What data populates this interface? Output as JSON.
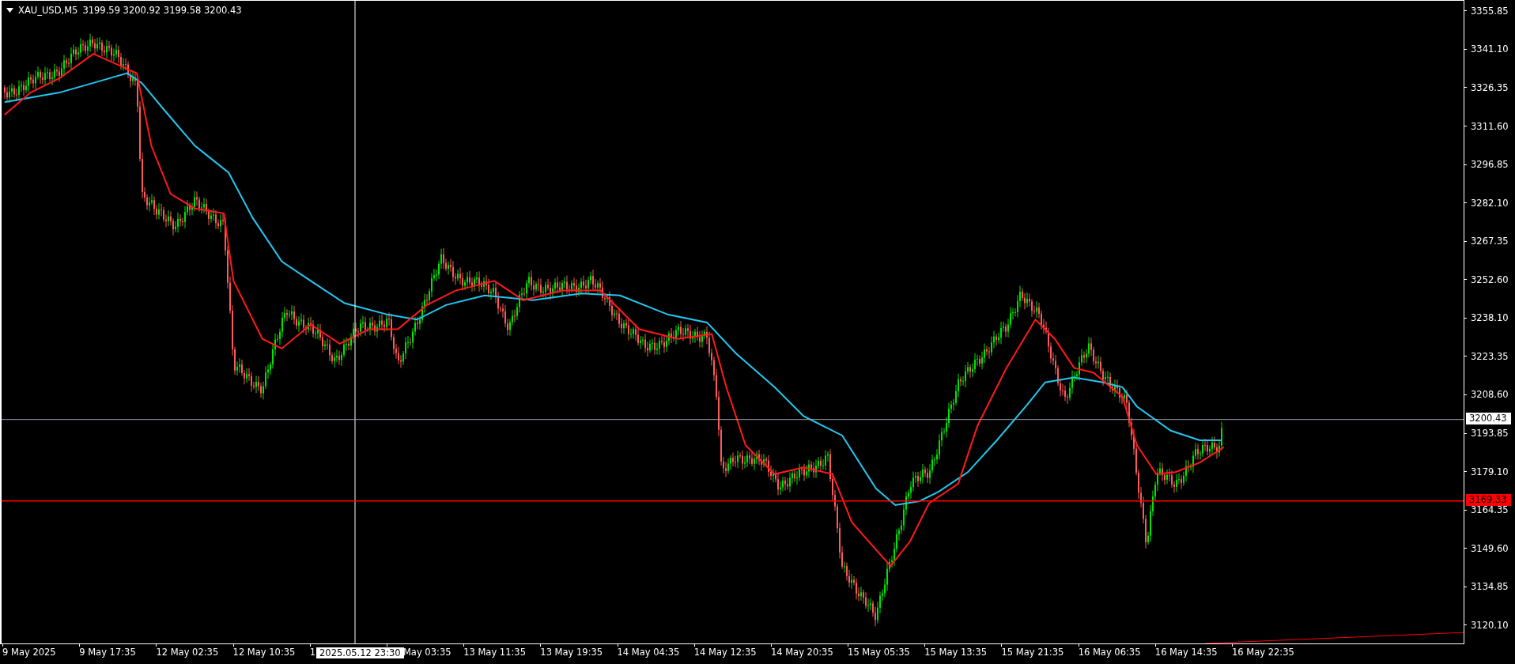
{
  "chart": {
    "symbol": "XAU_USD,M5",
    "ohlc": "3199.59 3200.92 3199.58 3200.43"
  },
  "y_axis": {
    "labels": [
      "3355.85",
      "3341.10",
      "3326.35",
      "3311.60",
      "3296.85",
      "3282.10",
      "3267.35",
      "3252.60",
      "3238.10",
      "3223.35",
      "3208.60",
      "3193.85",
      "3179.10",
      "3164.35",
      "3149.60",
      "3134.85",
      "3120.10"
    ]
  },
  "price_tags": [
    {
      "kind": "bid",
      "text": "3200.43"
    },
    {
      "kind": "line",
      "text": "3169.33"
    }
  ],
  "x_axis": {
    "labels": [
      {
        "text": "9 May 2025",
        "kind": "full"
      },
      {
        "text": "9 May 17:35",
        "kind": "full"
      },
      {
        "text": "12 May 02:35",
        "kind": "full"
      },
      {
        "text": "12 May 10:35",
        "kind": "full"
      },
      {
        "text": "1",
        "kind": "cut_right"
      },
      {
        "text": "May 03:35",
        "kind": "cut_left"
      },
      {
        "text": "13 May 11:35",
        "kind": "full"
      },
      {
        "text": "13 May 19:35",
        "kind": "full"
      },
      {
        "text": "14 May 04:35",
        "kind": "full"
      },
      {
        "text": "14 May 12:35",
        "kind": "full"
      },
      {
        "text": "14 May 20:35",
        "kind": "full"
      },
      {
        "text": "15 May 05:35",
        "kind": "full"
      },
      {
        "text": "15 May 13:35",
        "kind": "full"
      },
      {
        "text": "15 May 21:35",
        "kind": "full"
      },
      {
        "text": "16 May 06:35",
        "kind": "full"
      },
      {
        "text": "16 May 14:35",
        "kind": "full"
      },
      {
        "text": "16 May 22:35",
        "kind": "full"
      }
    ]
  },
  "crosshair": {
    "time": "2025.05.12 23:30"
  }
}
